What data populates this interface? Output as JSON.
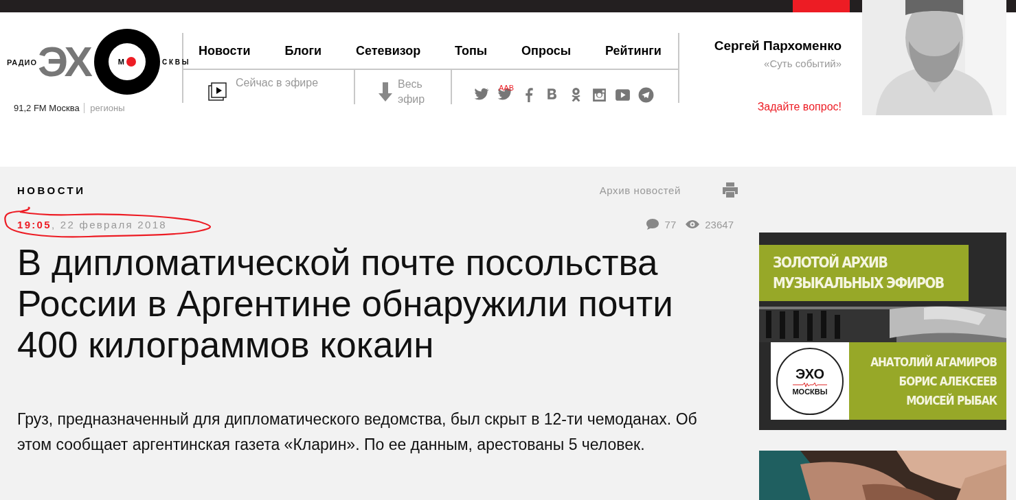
{
  "logo": {
    "radio": "РАДИО",
    "echo": "ЭХ",
    "moscow_first": "М",
    "moscow_rest": "С К В Ы",
    "frequency": "91,2 FM Москва",
    "regions": "регионы"
  },
  "nav": [
    {
      "label": "Новости"
    },
    {
      "label": "Блоги"
    },
    {
      "label": "Сетевизор"
    },
    {
      "label": "Топы"
    },
    {
      "label": "Опросы"
    },
    {
      "label": "Рейтинги"
    }
  ],
  "on_air": {
    "label": "Сейчас в эфире"
  },
  "archive_link": {
    "label": "Весь эфир"
  },
  "social": {
    "badge": "AAB"
  },
  "host": {
    "name": "Сергей Пархоменко",
    "show": "«Суть событий»",
    "ask": "Задайте вопрос!"
  },
  "section": {
    "title": "НОВОСТИ",
    "archive": "Архив новостей"
  },
  "article": {
    "time": "19:05",
    "date": ", 22 февраля 2018",
    "comments": "77",
    "views": "23647",
    "annotated": true,
    "title": "В дипломатической почте посольства России в Аргентине обнаружили почти 400 килограммов кокаин",
    "lead": "Груз, предназначенный для дипломатического ведомства, был скрыт в 12-ти чемоданах. Об этом сообщает аргентинская газета «Кларин». По ее данным, арестованы 5 человек."
  },
  "banner": {
    "headline": [
      "ЗОЛОТОЙ АРХИВ",
      "МУЗЫКАЛЬНЫХ ЭФИРОВ"
    ],
    "logo_top": "ЭХО",
    "logo_bottom": "МОСКВЫ",
    "names": [
      "АНАТОЛИЙ АГАМИРОВ",
      "БОРИС АЛЕКСЕЕВ",
      "МОИСЕЙ РЫБАК"
    ]
  }
}
